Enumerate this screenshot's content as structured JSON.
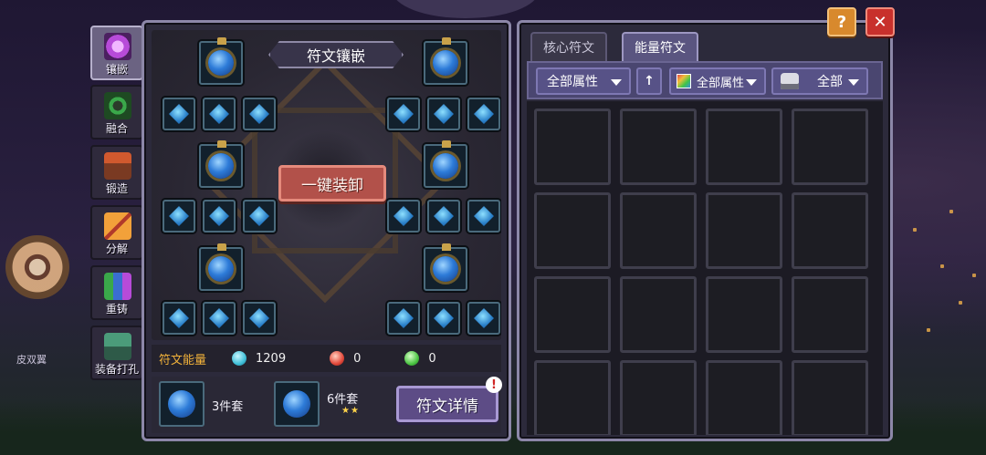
{
  "side_tabs": [
    {
      "label": "镶嵌",
      "icon": "rune-inlay-icon",
      "color": "#b74bd9"
    },
    {
      "label": "融合",
      "icon": "fusion-icon",
      "color": "#3aa84a"
    },
    {
      "label": "锻造",
      "icon": "anvil-icon",
      "color": "#a4472a"
    },
    {
      "label": "分解",
      "icon": "decompose-icon",
      "color": "#d0732a"
    },
    {
      "label": "重铸",
      "icon": "recast-icon",
      "color": "#3a8f9a"
    },
    {
      "label": "装备打孔",
      "icon": "drill-icon",
      "color": "#4b9c7a"
    }
  ],
  "rune_panel": {
    "title": "符文镶嵌",
    "unequip_label": "一键装卸",
    "energy": {
      "label": "符文能量",
      "blue": "1209",
      "red": "0",
      "green": "0"
    },
    "sets": [
      {
        "label": "3件套",
        "stars": ""
      },
      {
        "label": "6件套",
        "stars": "★★"
      }
    ],
    "detail_label": "符文详情",
    "badge": "!"
  },
  "storage_panel": {
    "tabs": [
      "核心符文",
      "能量符文"
    ],
    "active_tab": 1,
    "filters": {
      "attribute": "全部属性",
      "sort_arrow": "↑",
      "element": "全部属性",
      "type": "全部"
    }
  },
  "background": {
    "side_text": "皮双翼"
  },
  "buttons": {
    "help": "?",
    "close": "✕"
  },
  "colors": {
    "panel_border": "#8c87a8",
    "unequip_red": "#b2514a",
    "detail_purple": "#5d4c86",
    "energy_gold": "#f2b23a",
    "help_orange": "#d8892d",
    "close_red": "#c8302c"
  }
}
